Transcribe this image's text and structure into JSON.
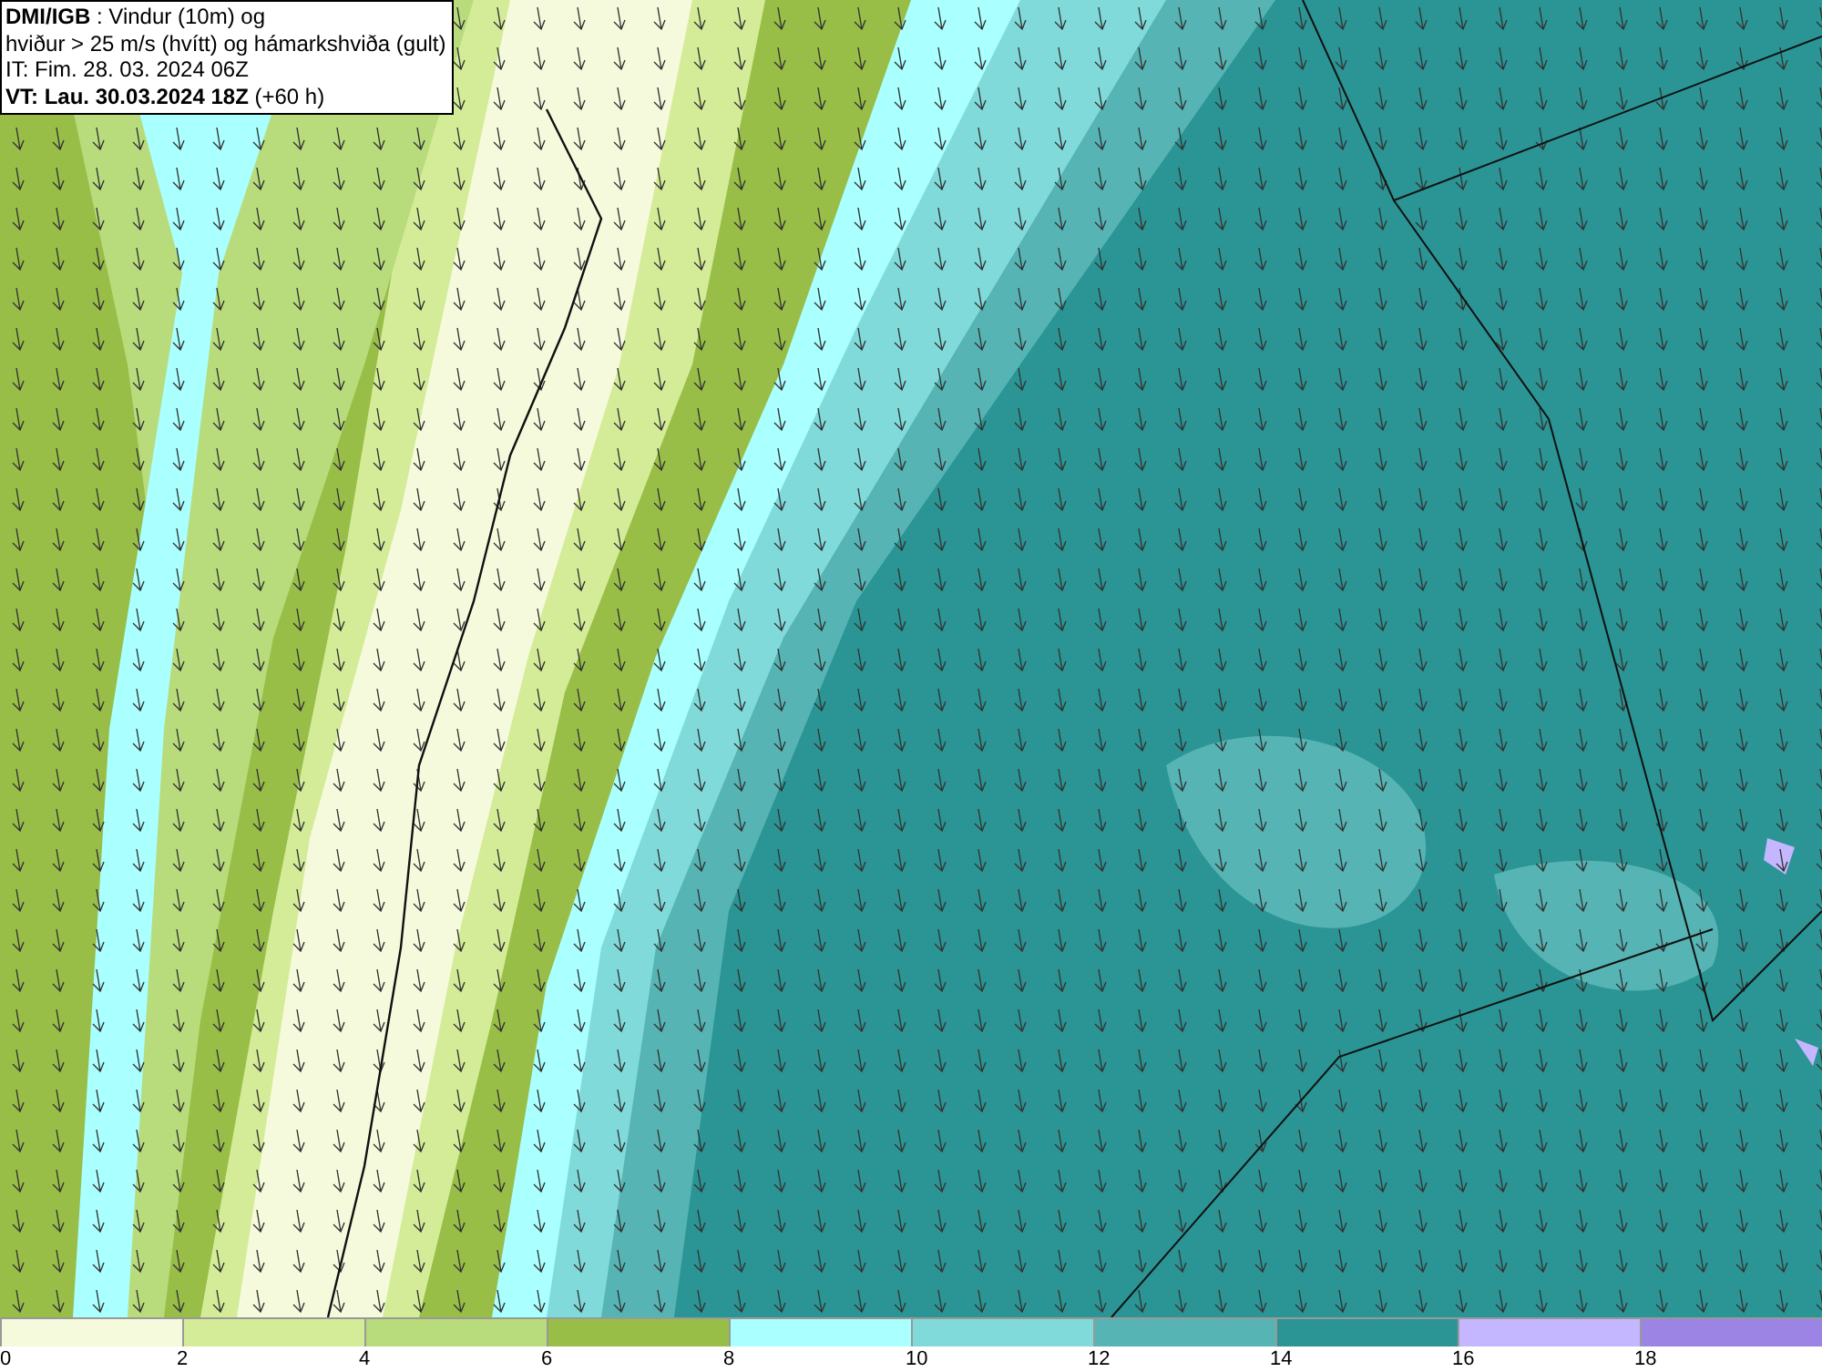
{
  "title_box": {
    "lines": [
      "**DMI/IGB** : Vindur (10m) og",
      "hviður > 25 m/s (hvítt) og hámarkshviða (gult)",
      "IT: Fim. 28. 03. 2024 06Z",
      "**VT: Lau. 30.03.2024 18Z** (+60 h)"
    ]
  },
  "legend": {
    "bins": [
      {
        "color": "#f5fadc",
        "tick": "0"
      },
      {
        "color": "#d4ec98",
        "tick": "2"
      },
      {
        "color": "#b8dc7c",
        "tick": "4"
      },
      {
        "color": "#98be48",
        "tick": "6"
      },
      {
        "color": "#aaffff",
        "tick": "8"
      },
      {
        "color": "#80dada",
        "tick": "10"
      },
      {
        "color": "#56b4b4",
        "tick": "12"
      },
      {
        "color": "#2b9494",
        "tick": "14"
      },
      {
        "color": "#c4b6ff",
        "tick": "16"
      },
      {
        "color": "#9c84e4",
        "tick": "18"
      }
    ]
  }
}
